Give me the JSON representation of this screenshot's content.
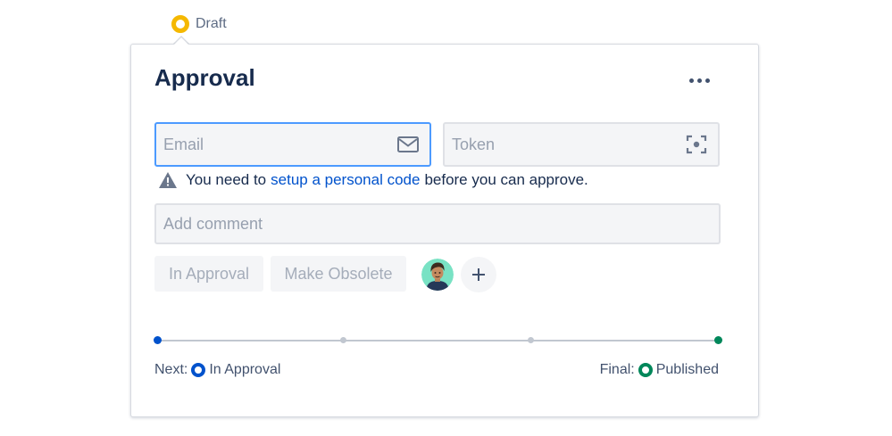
{
  "status": {
    "label": "Draft",
    "color": "#f5b800",
    "icon": "ring-icon"
  },
  "card": {
    "title": "Approval",
    "more_icon": "more-horizontal-icon"
  },
  "inputs": {
    "email": {
      "placeholder": "Email",
      "value": "",
      "icon": "mail-icon",
      "focused": true
    },
    "token": {
      "placeholder": "Token",
      "value": "",
      "icon": "scan-icon"
    },
    "comment": {
      "placeholder": "Add comment",
      "value": ""
    }
  },
  "warning": {
    "icon": "warning-triangle-icon",
    "text_before": "You need to",
    "link": "setup a personal code",
    "text_after": "before you can approve."
  },
  "actions": {
    "in_approval": "In Approval",
    "make_obsolete": "Make Obsolete",
    "add_icon": "plus-icon"
  },
  "workflow": {
    "next_label": "Next:",
    "next_state": "In Approval",
    "next_color": "#0052cc",
    "final_label": "Final:",
    "final_state": "Published",
    "final_color": "#00875a",
    "steps_total": 4,
    "current_step": 1
  },
  "colors": {
    "primary": "#0052cc",
    "success": "#00875a",
    "warning": "#f5b800",
    "title": "#172b4d"
  }
}
